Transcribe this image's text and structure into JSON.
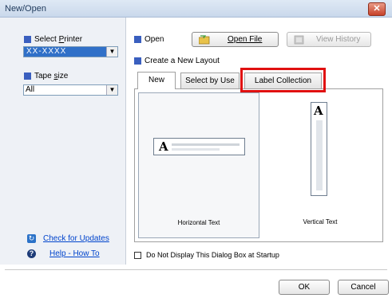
{
  "window": {
    "title": "New/Open",
    "close_glyph": "✕"
  },
  "left": {
    "printer": {
      "label_prefix": "Select ",
      "label_key": "P",
      "label_rest": "rinter",
      "value": "XX-XXXX"
    },
    "tape": {
      "label_prefix": "Tape ",
      "label_key": "s",
      "label_rest": "ize",
      "value": "All"
    },
    "links": {
      "updates": "Check for Updates",
      "help": "Help - How To"
    }
  },
  "main": {
    "open_label": "Open",
    "open_file_label": "Open File",
    "view_history_label": "View History",
    "create_label": "Create a New Layout",
    "tabs": [
      {
        "label": "New"
      },
      {
        "label": "Select by Use"
      },
      {
        "label": "Label  Collection"
      }
    ],
    "layouts": {
      "horizontal": {
        "label": "Horizontal Text",
        "glyph": "A"
      },
      "vertical": {
        "label": "Vertical Text",
        "glyph": "A"
      }
    },
    "checkbox_label": "Do Not Display This Dialog Box at Startup"
  },
  "footer": {
    "ok_label": "OK",
    "cancel_label": "Cancel"
  },
  "colors": {
    "accent": "#3a5fbf",
    "highlight": "#e01010",
    "link": "#0044cc"
  }
}
